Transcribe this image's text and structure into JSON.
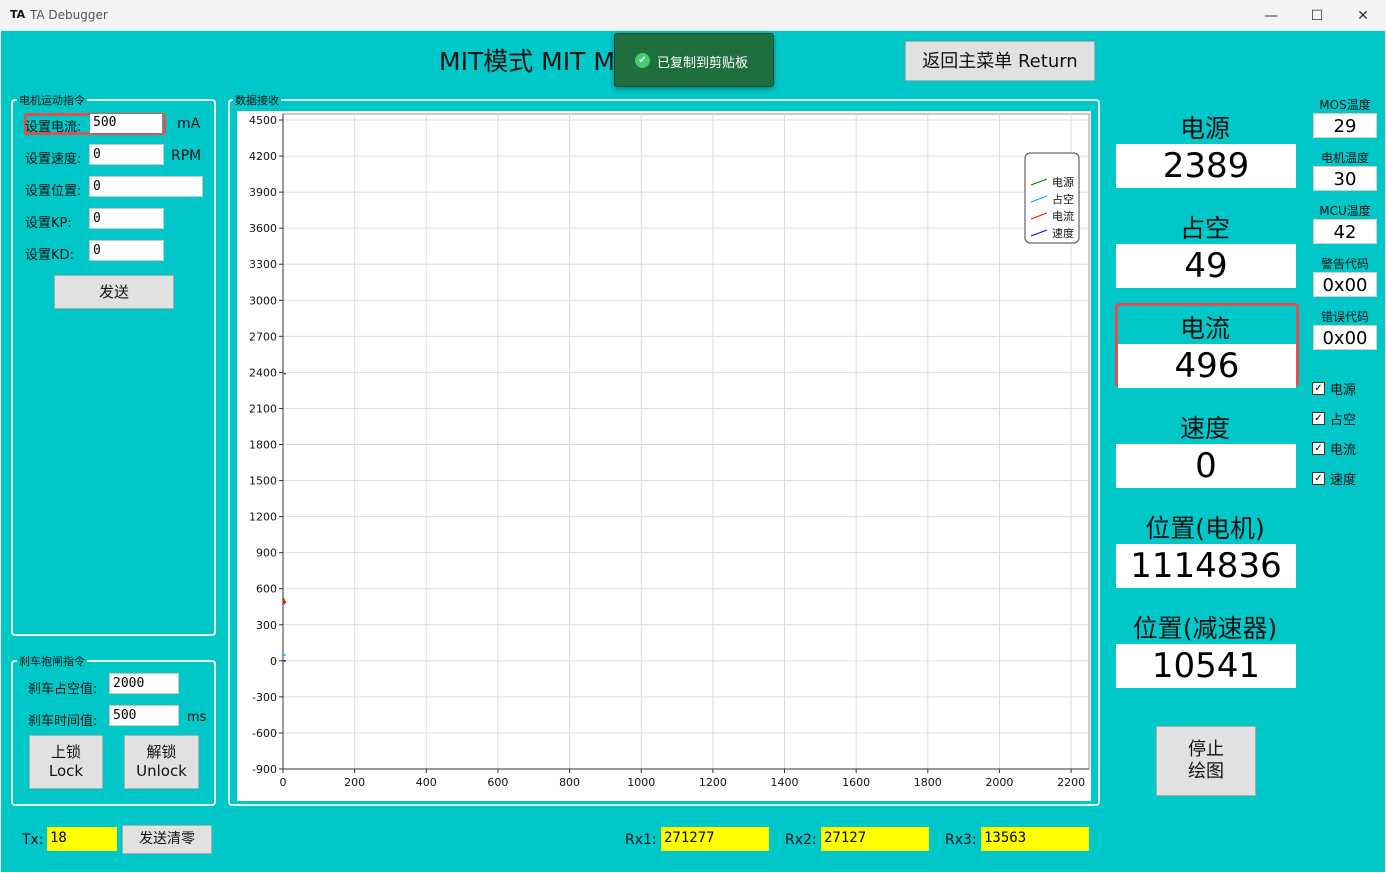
{
  "window": {
    "logo": "TA",
    "title": "TA Debugger",
    "minimize": "—",
    "maximize": "☐",
    "close": "✕"
  },
  "header": {
    "title": "MIT模式 MIT Mode",
    "return_label": "返回主菜单 Return"
  },
  "toast": {
    "text": "已复制到剪贴板",
    "icon": "check-circle-icon"
  },
  "motion": {
    "group_label": "电机运动指令",
    "current_label": "设置电流:",
    "current_value": "500",
    "current_unit": "mA",
    "speed_label": "设置速度:",
    "speed_value": "0",
    "speed_unit": "RPM",
    "position_label": "设置位置:",
    "position_value": "0",
    "kp_label": "设置KP:",
    "kp_value": "0",
    "kd_label": "设置KD:",
    "kd_value": "0",
    "send_label": "发送"
  },
  "brake": {
    "group_label": "刹车抱闸指令",
    "duty_label": "刹车占空值:",
    "duty_value": "2000",
    "time_label": "刹车时间值:",
    "time_value": "500",
    "time_unit": "ms",
    "lock_line1": "上锁",
    "lock_line2": "Lock",
    "unlock_line1": "解锁",
    "unlock_line2": "Unlock"
  },
  "chart_panel": {
    "group_label": "数据接收"
  },
  "chart_data": {
    "type": "line",
    "xlim": [
      0,
      2250
    ],
    "ylim": [
      -900,
      4550
    ],
    "x_ticks": [
      0,
      200,
      400,
      600,
      800,
      1000,
      1200,
      1400,
      1600,
      1800,
      2000,
      2200
    ],
    "y_ticks": [
      4500,
      4200,
      3900,
      3600,
      3300,
      3000,
      2700,
      2400,
      2100,
      1800,
      1500,
      1200,
      900,
      600,
      300,
      0,
      -300,
      -600,
      -900
    ],
    "grid": true,
    "legend_position": "top-right",
    "series": [
      {
        "name": "电源",
        "color": "#008000",
        "points": [
          [
            2,
            2389
          ],
          [
            8,
            2389
          ]
        ]
      },
      {
        "name": "占空",
        "color": "#00aaff",
        "points": [
          [
            2,
            49
          ],
          [
            8,
            49
          ]
        ]
      },
      {
        "name": "电流",
        "color": "#ff0000",
        "points": [
          [
            2,
            520
          ],
          [
            4,
            480
          ],
          [
            8,
            496
          ]
        ]
      },
      {
        "name": "速度",
        "color": "#0000ff",
        "points": [
          [
            2,
            0
          ],
          [
            8,
            0
          ]
        ]
      }
    ]
  },
  "metrics": [
    {
      "label": "电源",
      "value": "2389",
      "highlight": false
    },
    {
      "label": "占空",
      "value": "49",
      "highlight": false
    },
    {
      "label": "电流",
      "value": "496",
      "highlight": true
    },
    {
      "label": "速度",
      "value": "0",
      "highlight": false
    },
    {
      "label": "位置(电机)",
      "value": "1114836",
      "highlight": false
    },
    {
      "label": "位置(减速器)",
      "value": "10541",
      "highlight": false
    }
  ],
  "status": [
    {
      "label": "MOS温度",
      "value": "29"
    },
    {
      "label": "电机温度",
      "value": "30"
    },
    {
      "label": "MCU温度",
      "value": "42"
    },
    {
      "label": "警告代码",
      "value": "0x00"
    },
    {
      "label": "错误代码",
      "value": "0x00"
    }
  ],
  "toggles": [
    {
      "label": "电源",
      "checked": true
    },
    {
      "label": "占空",
      "checked": true
    },
    {
      "label": "电流",
      "checked": true
    },
    {
      "label": "速度",
      "checked": true
    }
  ],
  "stop_plot": {
    "line1": "停止",
    "line2": "绘图"
  },
  "footer": {
    "tx_label": "Tx:",
    "tx_value": "18",
    "clear_label": "发送清零",
    "rx1_label": "Rx1:",
    "rx1_value": "271277",
    "rx2_label": "Rx2:",
    "rx2_value": "27127",
    "rx3_label": "Rx3:",
    "rx3_value": "13563"
  },
  "colors": {
    "background": "#00c8c8",
    "highlight": "#e05050",
    "counter": "#ffff00"
  }
}
